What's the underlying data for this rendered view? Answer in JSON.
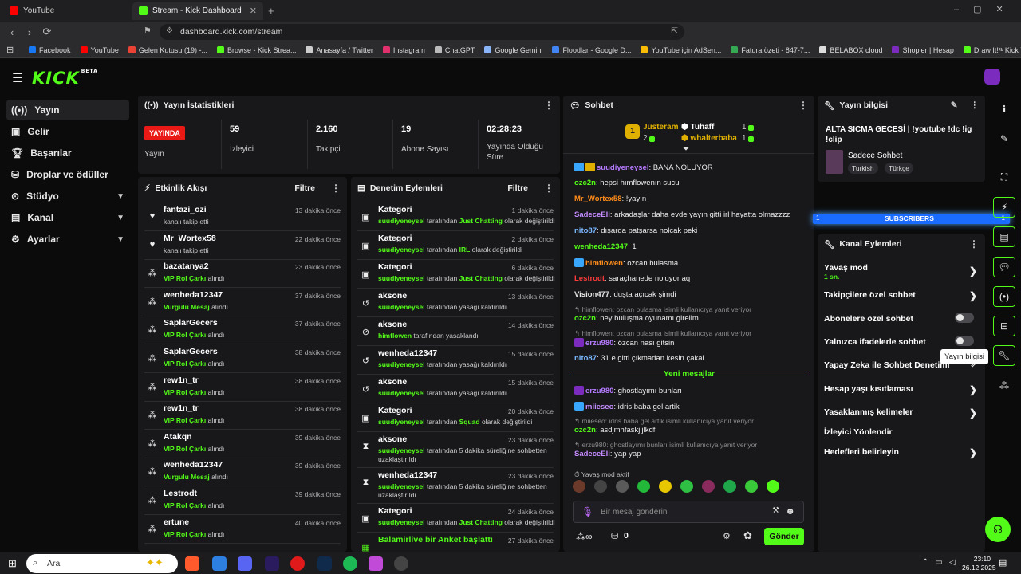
{
  "browser": {
    "tabs": [
      {
        "title": "YouTube",
        "color": "#ff0000"
      },
      {
        "title": "Stream - Kick Dashboard",
        "color": "#53fc18"
      }
    ],
    "url": "dashboard.kick.com/stream",
    "bookmarks": [
      {
        "label": "Facebook",
        "color": "#1877f2"
      },
      {
        "label": "YouTube",
        "color": "#ff0000"
      },
      {
        "label": "Gelen Kutusu (19) -...",
        "color": "#ea4335"
      },
      {
        "label": "Browse - Kick Strea...",
        "color": "#53fc18"
      },
      {
        "label": "Anasayfa / Twitter",
        "color": "#cccccc"
      },
      {
        "label": "Instagram",
        "color": "#e1306c"
      },
      {
        "label": "ChatGPT",
        "color": "#bbbbbb"
      },
      {
        "label": "Google Gemini",
        "color": "#8ab4f8"
      },
      {
        "label": "Floodlar - Google D...",
        "color": "#4285f4"
      },
      {
        "label": "YouTube için AdSen...",
        "color": "#fbbc04"
      },
      {
        "label": "Fatura özeti - 847-7...",
        "color": "#34a853"
      },
      {
        "label": "BELABOX cloud",
        "color": "#dddddd"
      },
      {
        "label": "Shopier | Hesap",
        "color": "#7b2cbf"
      },
      {
        "label": "Draw It! - Kick Yayın...",
        "color": "#53fc18"
      }
    ]
  },
  "app": {
    "logo": "KICK",
    "logo_sup": "BETA",
    "accent": "#53fc18"
  },
  "sidebar": {
    "items": [
      {
        "label": "Yayın",
        "icon": "broadcast-icon"
      },
      {
        "label": "Gelir",
        "icon": "wallet-icon"
      },
      {
        "label": "Başarılar",
        "icon": "trophy-icon"
      },
      {
        "label": "Droplar ve ödüller",
        "icon": "gift-icon"
      },
      {
        "label": "Stüdyo",
        "icon": "studio-icon"
      },
      {
        "label": "Kanal",
        "icon": "channel-icon"
      },
      {
        "label": "Ayarlar",
        "icon": "gear-icon"
      }
    ]
  },
  "stats": {
    "title": "Yayın İstatistikleri",
    "live_badge": "YAYINDA",
    "live_label": "Yayın",
    "items": [
      {
        "value": "59",
        "label": "İzleyici"
      },
      {
        "value": "2.160",
        "label": "Takipçi"
      },
      {
        "value": "19",
        "label": "Abone Sayısı"
      },
      {
        "value": "02:28:23",
        "label": "Yayında Olduğu Süre"
      }
    ]
  },
  "activity": {
    "title": "Etkinlik Akışı",
    "filter": "Filtre",
    "items": [
      {
        "name": "fantazi_ozi",
        "pre": "kanalı takip etti",
        "hl": "",
        "post": "",
        "time": "13 dakika önce",
        "icon": "heart-icon"
      },
      {
        "name": "Mr_Wortex58",
        "pre": "kanalı takip etti",
        "hl": "",
        "post": "",
        "time": "22 dakika önce",
        "icon": "heart-icon"
      },
      {
        "name": "bazatanya2",
        "pre": "",
        "hl": "VIP Rol Çarkı",
        "post": " alındı",
        "time": "23 dakika önce",
        "icon": "points-icon"
      },
      {
        "name": "wenheda12347",
        "pre": "",
        "hl": "Vurgulu Mesaj",
        "post": " alındı",
        "time": "37 dakika önce",
        "icon": "points-icon"
      },
      {
        "name": "SaplarGecers",
        "pre": "",
        "hl": "VIP Rol Çarkı",
        "post": " alındı",
        "time": "37 dakika önce",
        "icon": "points-icon"
      },
      {
        "name": "SaplarGecers",
        "pre": "",
        "hl": "VIP Rol Çarkı",
        "post": " alındı",
        "time": "38 dakika önce",
        "icon": "points-icon"
      },
      {
        "name": "rew1n_tr",
        "pre": "",
        "hl": "VIP Rol Çarkı",
        "post": " alındı",
        "time": "38 dakika önce",
        "icon": "points-icon"
      },
      {
        "name": "rew1n_tr",
        "pre": "",
        "hl": "VIP Rol Çarkı",
        "post": " alındı",
        "time": "38 dakika önce",
        "icon": "points-icon"
      },
      {
        "name": "Atakqn",
        "pre": "",
        "hl": "VIP Rol Çarkı",
        "post": " alındı",
        "time": "39 dakika önce",
        "icon": "points-icon"
      },
      {
        "name": "wenheda12347",
        "pre": "",
        "hl": "Vurgulu Mesaj",
        "post": " alındı",
        "time": "39 dakika önce",
        "icon": "points-icon"
      },
      {
        "name": "Lestrodt",
        "pre": "",
        "hl": "VIP Rol Çarkı",
        "post": " alındı",
        "time": "39 dakika önce",
        "icon": "points-icon"
      },
      {
        "name": "ertune",
        "pre": "",
        "hl": "VIP Rol Çarkı",
        "post": " alındı",
        "time": "40 dakika önce",
        "icon": "points-icon"
      }
    ]
  },
  "moderation": {
    "title": "Denetim Eylemleri",
    "filter": "Filtre",
    "items": [
      {
        "name": "Kategori",
        "who": "suudiyeneysel",
        "mid": " tarafından ",
        "hl": "Just Chatting",
        "post": " olarak değiştirildi",
        "time": "1 dakika önce",
        "icon": "category-icon"
      },
      {
        "name": "Kategori",
        "who": "suudiyeneysel",
        "mid": " tarafından ",
        "hl": "IRL",
        "post": " olarak değiştirildi",
        "time": "2 dakika önce",
        "icon": "category-icon"
      },
      {
        "name": "Kategori",
        "who": "suudiyeneysel",
        "mid": " tarafından ",
        "hl": "Just Chatting",
        "post": " olarak değiştirildi",
        "time": "6 dakika önce",
        "icon": "category-icon"
      },
      {
        "name": "aksone",
        "who": "suudiyeneysel",
        "mid": " tarafından yasağı kaldırıldı",
        "hl": "",
        "post": "",
        "time": "13 dakika önce",
        "icon": "unban-icon"
      },
      {
        "name": "aksone",
        "who": "himflowen",
        "mid": " tarafından yasaklandı",
        "hl": "",
        "post": "",
        "time": "14 dakika önce",
        "icon": "ban-icon"
      },
      {
        "name": "wenheda12347",
        "who": "suudiyeneysel",
        "mid": " tarafından yasağı kaldırıldı",
        "hl": "",
        "post": "",
        "time": "15 dakika önce",
        "icon": "unban-icon"
      },
      {
        "name": "aksone",
        "who": "suudiyeneysel",
        "mid": " tarafından yasağı kaldırıldı",
        "hl": "",
        "post": "",
        "time": "15 dakika önce",
        "icon": "unban-icon"
      },
      {
        "name": "Kategori",
        "who": "suudiyeneysel",
        "mid": " tarafından ",
        "hl": "Squad",
        "post": "  olarak değiştirildi",
        "time": "20 dakika önce",
        "icon": "category-icon"
      },
      {
        "name": "aksone",
        "who": "suudiyeneysel",
        "mid": " tarafından 5 dakika süreliğine sohbetten uzaklaştırıldı",
        "hl": "",
        "post": "",
        "time": "23 dakika önce",
        "icon": "timeout-icon"
      },
      {
        "name": "wenheda12347",
        "who": "suudiyeneysel",
        "mid": " tarafından 5 dakika süreliğine sohbetten uzaklaştırıldı",
        "hl": "",
        "post": "",
        "time": "23 dakika önce",
        "icon": "timeout-icon"
      },
      {
        "name": "Kategori",
        "who": "suudiyeneysel",
        "mid": " tarafından ",
        "hl": "Just Chatting",
        "post": " olarak değiştirildi",
        "time": "24 dakika önce",
        "icon": "category-icon"
      },
      {
        "name": "Balamirlive bir Anket başlattı",
        "who": "",
        "mid": "",
        "hl": "",
        "post": "",
        "time": "27 dakika önce",
        "icon": "poll-icon"
      }
    ]
  },
  "chat": {
    "title": "Sohbet",
    "leaderboard": [
      {
        "rank": "1",
        "name": "Justeram",
        "count": "2"
      },
      {
        "name": "Tuhaff",
        "count": "1"
      },
      {
        "name": "whalterbaba",
        "count": "1"
      }
    ],
    "messages": [
      {
        "type": "msg",
        "user": "suudiyeneysel",
        "color": "#b57bff",
        "text": ": BANA NOLUYOR",
        "badges": [
          "#3aa7ff",
          "#e0b000"
        ]
      },
      {
        "type": "msg",
        "user": "ozc2n",
        "color": "#53fc18",
        "text": ": hepsi hımflowenın sucu",
        "badges": []
      },
      {
        "type": "msg",
        "user": "Mr_Wortex58",
        "color": "#ff8c1a",
        "text": ": !yayın",
        "badges": []
      },
      {
        "type": "msg",
        "user": "SadeceEli",
        "color": "#c58cff",
        "text": ": arkadaşlar daha evde yayın gitti irl hayatta olmazzzz",
        "badges": []
      },
      {
        "type": "msg",
        "user": "nito87",
        "color": "#7ab8ff",
        "text": ": dışarda patşarsa nolcak peki",
        "badges": []
      },
      {
        "type": "msg",
        "user": "wenheda12347",
        "color": "#53fc18",
        "text": ": 1",
        "badges": []
      },
      {
        "type": "msg",
        "user": "himflowen",
        "color": "#ff8c1a",
        "text": ": ozcan bulasma",
        "badges": [
          "#3aa7ff"
        ]
      },
      {
        "type": "msg",
        "user": "Lestrodt",
        "color": "#ff3b3b",
        "text": ": saraçhanede noluyor aq",
        "badges": []
      },
      {
        "type": "msg",
        "user": "Vision477",
        "color": "#e8e8e8",
        "text": ": duşta açıcak şimdi",
        "badges": []
      },
      {
        "type": "reply",
        "text": "↰ himflowen: ozcan bulasma isimli kullanıcıya yanıt veriyor"
      },
      {
        "type": "msg",
        "user": "ozc2n",
        "color": "#53fc18",
        "text": ": ney buluşma oyunamı girelim",
        "badges": []
      },
      {
        "type": "reply",
        "text": "↰ himflowen: ozcan bulasma isimli kullanıcıya yanıt veriyor"
      },
      {
        "type": "msg",
        "user": "erzu980",
        "color": "#b57bff",
        "text": ": özcan nası gitsin",
        "badges": [
          "#7b2cbf"
        ]
      },
      {
        "type": "msg",
        "user": "nito87",
        "color": "#7ab8ff",
        "text": ": 31 e gitti çıkmadan kesin çakal",
        "badges": []
      }
    ],
    "new_messages": "Yeni mesajlar",
    "new": [
      {
        "type": "msg",
        "user": "erzu980",
        "color": "#b57bff",
        "text": ": ghostlayımı bunları",
        "badges": [
          "#7b2cbf"
        ]
      },
      {
        "type": "msg",
        "user": "miieseo",
        "color": "#c58cff",
        "text": ": idris baba gel artik",
        "badges": [
          "#3aa7ff"
        ]
      },
      {
        "type": "reply",
        "text": "↰ miieseo: idris baba gel artik isimli kullanıcıya yanıt veriyor"
      },
      {
        "type": "msg",
        "user": "ozc2n",
        "color": "#53fc18",
        "text": ": asdjmhfaskjljlkdf",
        "badges": []
      },
      {
        "type": "reply",
        "text": "↰ erzu980: ghostlayımı bunları isimli kullanıcıya yanıt veriyor"
      },
      {
        "type": "msg",
        "user": "SadeceEli",
        "color": "#c58cff",
        "text": ": yap yap",
        "badges": []
      }
    ],
    "slow_mode": "Yavaş mod aktif",
    "placeholder": "Bir mesaj gönderin",
    "points": "0",
    "send": "Gönder"
  },
  "stream_info": {
    "title": "Yayın bilgisi",
    "stream_title": "ALTA SICMA GECESİ | !youtube !dc !ig !clip",
    "category": "Sadece Sohbet",
    "tags": [
      "Turkish",
      "Türkçe"
    ],
    "subscribers_bar": "SUBSCRIBERS",
    "bar_left": "1",
    "bar_right": "1"
  },
  "channel_actions": {
    "title": "Kanal Eylemleri",
    "slow_mode_value": "1 sn.",
    "items": [
      {
        "label": "Yavaş mod",
        "control": "chevron"
      },
      {
        "label": "Takipçilere özel sohbet",
        "control": "chevron"
      },
      {
        "label": "Abonelere özel sohbet",
        "control": "toggle"
      },
      {
        "label": "Yalnızca ifadelerle sohbet",
        "control": "toggle"
      },
      {
        "label": "Yapay Zeka ile Sohbet Denetimi",
        "control": "external"
      },
      {
        "label": "Hesap yaşı kısıtlaması",
        "control": "chevron"
      },
      {
        "label": "Yasaklanmış kelimeler",
        "control": "chevron"
      },
      {
        "label": "İzleyici Yönlendir",
        "control": "none"
      },
      {
        "label": "Hedefleri belirleyin",
        "control": "chevron"
      }
    ]
  },
  "tooltip": "Yayın bilgisi",
  "taskbar": {
    "search": "Ara",
    "time": "23:10",
    "date": "26.12.2025"
  }
}
